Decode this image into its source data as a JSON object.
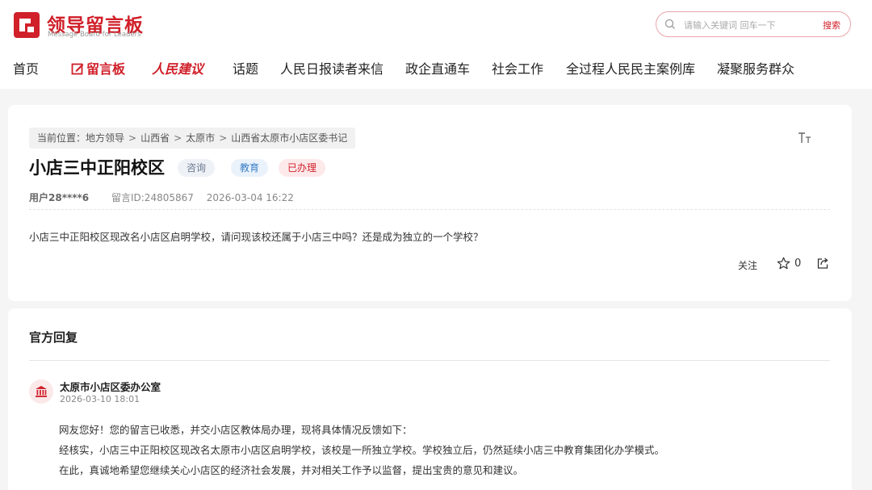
{
  "header": {
    "logo_title": "领导留言板",
    "logo_subtitle": "Message Board for Leaders",
    "search_placeholder": "请输入关键词 回车一下",
    "search_button": "搜索"
  },
  "nav": {
    "items": [
      {
        "label": "首页"
      },
      {
        "label": "留言板",
        "active": true
      },
      {
        "label": "人民建议"
      },
      {
        "label": "话题"
      },
      {
        "label": "人民日报读者来信"
      },
      {
        "label": "政企直通车"
      },
      {
        "label": "社会工作"
      },
      {
        "label": "全过程人民民主案例库"
      },
      {
        "label": "凝聚服务群众"
      }
    ]
  },
  "breadcrumb": {
    "prefix": "当前位置：",
    "items": [
      "地方领导",
      "山西省",
      "太原市",
      "山西省太原市小店区委书记"
    ],
    "separator": ">"
  },
  "message": {
    "title": "小店三中正阳校区",
    "tags": [
      "咨询",
      "教育",
      "已办理"
    ],
    "user": "用户28****6",
    "message_id": "留言ID:24805867",
    "time": "2026-03-04 16:22",
    "content": "小店三中正阳校区现改名小店区启明学校，请问现该校还属于小店三中吗？还是成为独立的一个学校？",
    "follow_label": "关注",
    "like_count": "0"
  },
  "reply": {
    "heading": "官方回复",
    "org": "太原市小店区委办公室",
    "time": "2026-03-10 18:01",
    "lines": [
      "网友您好！您的留言已收悉，并交小店区教体局办理，现将具体情况反馈如下：",
      "经核实，小店三中正阳校区现改名太原市小店区启明学校，该校是一所独立学校。学校独立后，仍然延续小店三中教育集团化办学模式。",
      "在此，真诚地希望您继续关心小店区的经济社会发展，并对相关工作予以监督，提出宝贵的意见和建议。"
    ]
  },
  "colors": {
    "brand_red": "#d0202a",
    "tag_consult": "#6b7a90",
    "tag_edu": "#3a7fc6",
    "tag_done": "#d0202a"
  },
  "icons": {
    "search": "search-icon",
    "font_size": "font-size-icon",
    "star": "star-icon",
    "share": "share-icon",
    "org": "government-building-icon"
  }
}
